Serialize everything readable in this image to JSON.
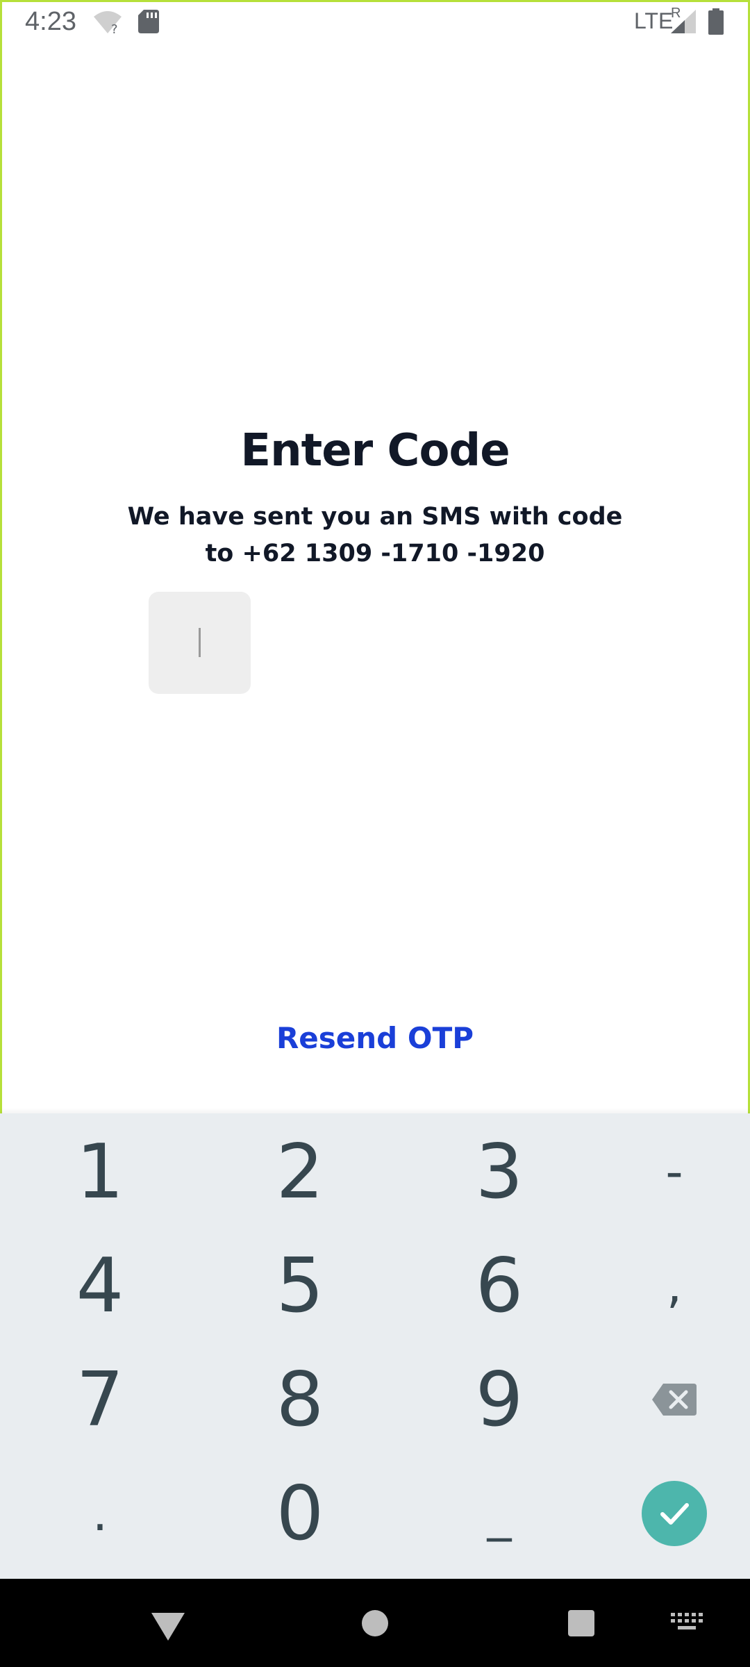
{
  "status_bar": {
    "time": "4:23",
    "network": "LTE",
    "roaming": "R",
    "icons": [
      "wifi-unknown-icon",
      "sd-card-icon",
      "signal-icon",
      "battery-icon"
    ]
  },
  "main": {
    "title": "Enter Code",
    "subtitle_line1": "We have sent you an SMS with code",
    "subtitle_line2": "to +62 1309 -1710 -1920",
    "otp_value": "",
    "resend_label": "Resend OTP"
  },
  "keyboard": {
    "keys": {
      "k1": "1",
      "k2": "2",
      "k3": "3",
      "dash": "-",
      "k4": "4",
      "k5": "5",
      "k6": "6",
      "comma": ",",
      "k7": "7",
      "k8": "8",
      "k9": "9",
      "dot": ".",
      "k0": "0",
      "space": "_"
    },
    "backspace_icon": "backspace-icon",
    "done_icon": "check-icon"
  },
  "colors": {
    "accent_frame": "#b6e03a",
    "link": "#1a3fd8",
    "done_button": "#4db6ac",
    "keyboard_bg": "#e9edf0"
  },
  "nav_bar": {
    "icons": [
      "back-icon",
      "home-icon",
      "recents-icon",
      "keyboard-switch-icon"
    ]
  }
}
